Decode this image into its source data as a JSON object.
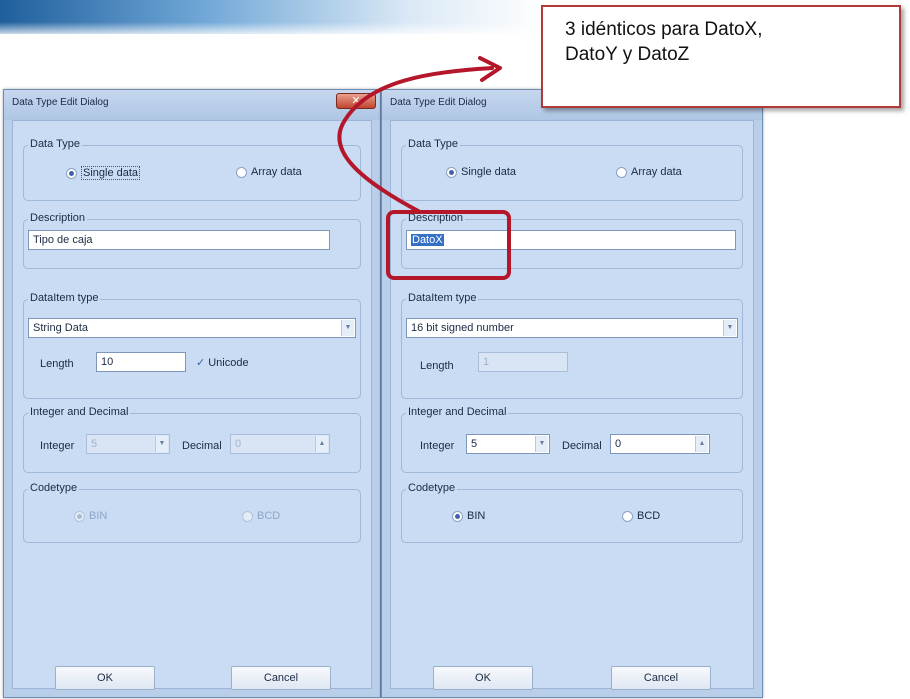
{
  "callout": {
    "line1": "3 idénticos para DatoX,",
    "line2": "DatoY y DatoZ"
  },
  "dialogs": [
    {
      "title": "Data Type Edit Dialog",
      "close_label": "✕",
      "data_type_group": "Data Type",
      "single_label": "Single data",
      "array_label": "Array data",
      "description_group": "Description",
      "description_value": "Tipo de caja",
      "dataitem_group": "DataItem type",
      "dataitem_value": "String Data",
      "length_label": "Length",
      "length_value": "10",
      "unicode_label": "Unicode",
      "int_dec_group": "Integer and Decimal",
      "integer_label": "Integer",
      "integer_value": "5",
      "decimal_label": "Decimal",
      "decimal_value": "0",
      "codetype_group": "Codetype",
      "bin_label": "BIN",
      "bcd_label": "BCD",
      "ok_label": "OK",
      "cancel_label": "Cancel"
    },
    {
      "title": "Data Type Edit Dialog",
      "data_type_group": "Data Type",
      "single_label": "Single data",
      "array_label": "Array data",
      "description_group": "Description",
      "description_value": "DatoX",
      "dataitem_group": "DataItem type",
      "dataitem_value": "16 bit signed number",
      "length_label": "Length",
      "length_value": "1",
      "int_dec_group": "Integer and Decimal",
      "integer_label": "Integer",
      "integer_value": "5",
      "decimal_label": "Decimal",
      "decimal_value": "0",
      "codetype_group": "Codetype",
      "bin_label": "BIN",
      "bcd_label": "BCD",
      "ok_label": "OK",
      "cancel_label": "Cancel"
    }
  ]
}
